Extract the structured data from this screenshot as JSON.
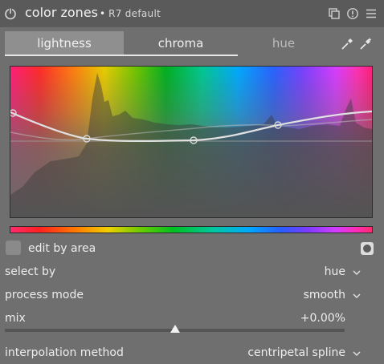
{
  "header": {
    "title": "color zones",
    "dot": "•",
    "preset": "R7 default"
  },
  "tabs": [
    {
      "label": "lightness",
      "active": true
    },
    {
      "label": "chroma",
      "underlined": true
    },
    {
      "label": "hue",
      "disabled": true
    }
  ],
  "icons": {
    "power": "power-icon",
    "multi_instance": "multi-instance-icon",
    "reset": "reset-icon",
    "presets": "presets-menu-icon",
    "picker": "color-picker-icon",
    "picker_plus": "color-picker-plus-icon",
    "area": "edit-area-mask-icon"
  },
  "edit_by_area": {
    "label": "edit by area",
    "checked": false
  },
  "select_by": {
    "label": "select by",
    "value": "hue"
  },
  "process_mode": {
    "label": "process mode",
    "value": "smooth"
  },
  "mix": {
    "label": "mix",
    "value": "+0.00%",
    "level": 0.5
  },
  "interpolation": {
    "label": "interpolation method",
    "value": "centripetal spline"
  },
  "colors": {
    "background": "#6f6f6f",
    "header": "#5a5a5a",
    "active_tab": "#8f8f8f",
    "curve": "#e0e0e0"
  }
}
